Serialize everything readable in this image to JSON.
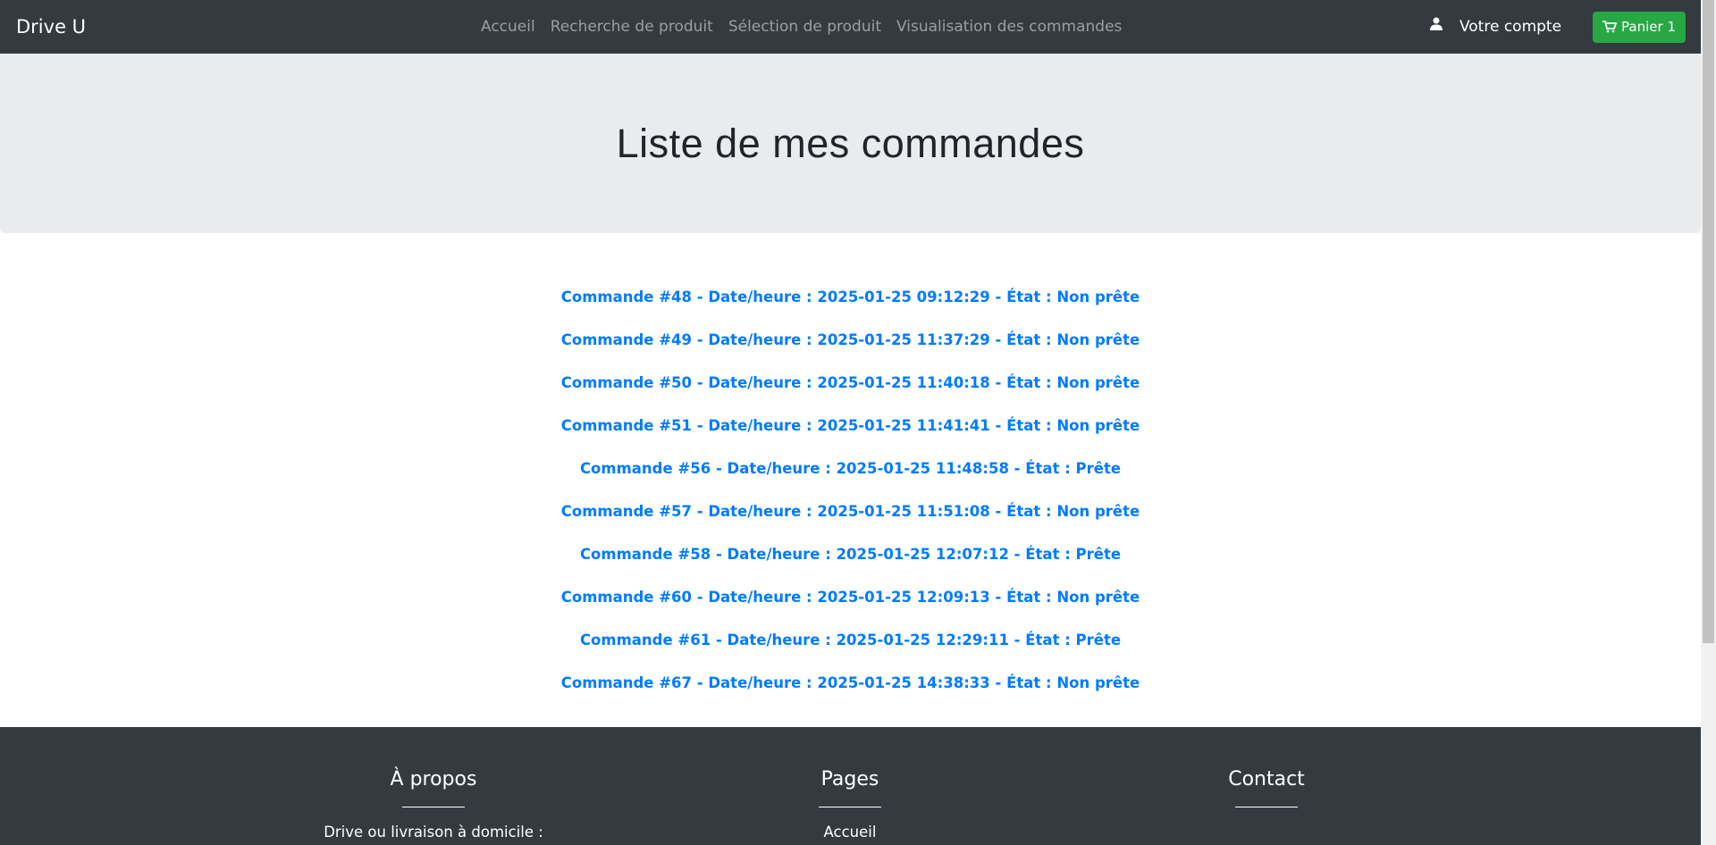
{
  "navbar": {
    "brand": "Drive U",
    "links": [
      "Accueil",
      "Recherche de produit",
      "Sélection de produit",
      "Visualisation des commandes"
    ],
    "account_label": "Votre compte",
    "cart_label": "Panier 1"
  },
  "jumbotron": {
    "title": "Liste de mes commandes"
  },
  "orders": [
    "Commande #48 - Date/heure : 2025-01-25 09:12:29 - État : Non prête",
    "Commande #49 - Date/heure : 2025-01-25 11:37:29 - État : Non prête",
    "Commande #50 - Date/heure : 2025-01-25 11:40:18 - État : Non prête",
    "Commande #51 - Date/heure : 2025-01-25 11:41:41 - État : Non prête",
    "Commande #56 - Date/heure : 2025-01-25 11:48:58 - État : Prête",
    "Commande #57 - Date/heure : 2025-01-25 11:51:08 - État : Non prête",
    "Commande #58 - Date/heure : 2025-01-25 12:07:12 - État : Prête",
    "Commande #60 - Date/heure : 2025-01-25 12:09:13 - État : Non prête",
    "Commande #61 - Date/heure : 2025-01-25 12:29:11 - État : Prête",
    "Commande #67 - Date/heure : 2025-01-25 14:38:33 - État : Non prête"
  ],
  "footer": {
    "about": {
      "title": "À propos",
      "line": "Drive ou livraison à domicile :"
    },
    "pages": {
      "title": "Pages",
      "line": "Accueil"
    },
    "contact": {
      "title": "Contact"
    }
  },
  "colors": {
    "navbar": "#343a40",
    "link": "#007bff",
    "cart": "#28a745",
    "jumbotron": "#e9ecef"
  }
}
